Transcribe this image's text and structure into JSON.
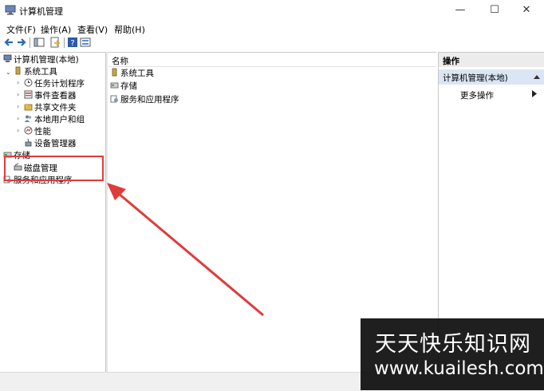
{
  "window": {
    "title": "计算机管理",
    "controls": {
      "minimize": "—",
      "maximize": "☐",
      "close": "✕"
    }
  },
  "menu": [
    "文件(F)",
    "操作(A)",
    "查看(V)",
    "帮助(H)"
  ],
  "toolbar": {
    "icons": [
      "back-arrow-icon",
      "forward-arrow-icon",
      "show-hide-tree-icon",
      "export-list-icon",
      "help-icon",
      "console-view-icon"
    ]
  },
  "tree": {
    "root": "计算机管理(本地)",
    "system_tools": "系统工具",
    "items": [
      "任务计划程序",
      "事件查看器",
      "共享文件夹",
      "本地用户和组",
      "性能",
      "设备管理器"
    ],
    "storage": "存储",
    "disk_management": "磁盘管理",
    "services": "服务和应用程序"
  },
  "center": {
    "column_header": "名称",
    "rows": [
      "系统工具",
      "存储",
      "服务和应用程序"
    ]
  },
  "actions": {
    "header": "操作",
    "group": "计算机管理(本地)",
    "more": "更多操作"
  },
  "annotation": {
    "highlight_color": "#e03b3b",
    "arrow_color": "#e03b3b"
  },
  "watermark": {
    "line1": "天天快乐知识网",
    "line2": "www.kuailesh.com"
  }
}
